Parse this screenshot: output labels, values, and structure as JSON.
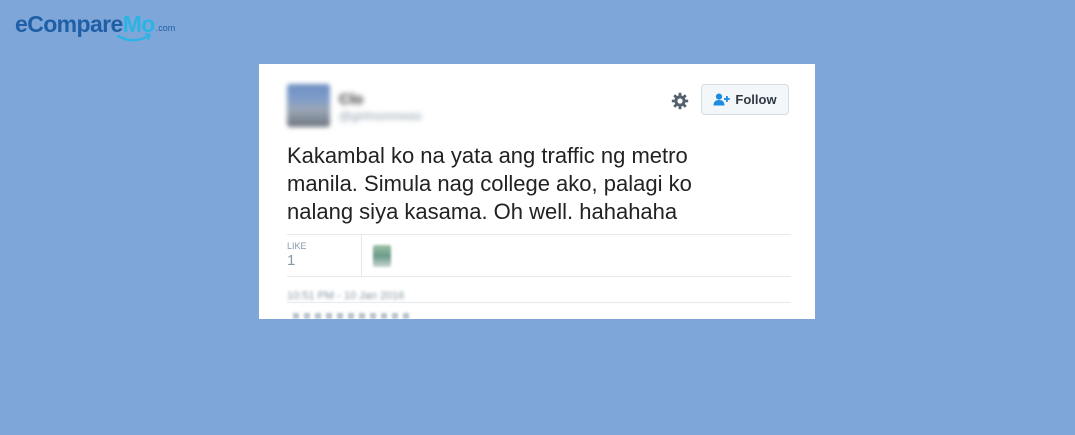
{
  "brand": {
    "logo_main": "eCompare",
    "logo_accent": "Mo",
    "logo_suffix": ".com"
  },
  "tweet": {
    "author_name": "Clo",
    "author_handle": "@girlmomnews",
    "follow_label": "Follow",
    "text": "Kakambal ko na yata ang traffic ng metro manila. Simula nag college ako, palagi ko nalang siya kasama. Oh well. hahahaha",
    "likes_label": "LIKE",
    "likes_count": "1",
    "timestamp": "10:51 PM - 10 Jan 2016"
  },
  "colors": {
    "background": "#7ea6d8",
    "card": "#ffffff",
    "brand_dark": "#1e5fa6",
    "brand_accent": "#2ab4e6"
  },
  "icons": {
    "settings": "gear-icon",
    "follow": "add-user-icon"
  }
}
